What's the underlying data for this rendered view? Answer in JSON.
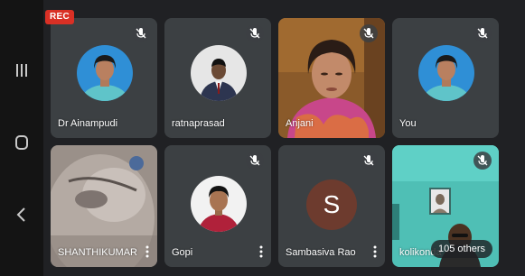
{
  "recording": {
    "label": "REC",
    "color": "#d93025"
  },
  "nav": {
    "recents_icon": "recents-icon",
    "home_icon": "home-icon",
    "back_icon": "back-icon"
  },
  "participants": [
    {
      "name": "Dr Ainampudi",
      "muted": true,
      "kind": "profile-photo"
    },
    {
      "name": "ratnaprasad",
      "muted": true,
      "kind": "profile-photo"
    },
    {
      "name": "Anjani",
      "muted": true,
      "kind": "video"
    },
    {
      "name": "You",
      "muted": true,
      "kind": "profile-photo"
    },
    {
      "name": "SHANTHIKUMAR",
      "muted": false,
      "kind": "video",
      "menu": true
    },
    {
      "name": "Gopi",
      "muted": true,
      "kind": "profile-photo",
      "menu": true
    },
    {
      "name": "Sambasiva Rao",
      "muted": true,
      "kind": "initial-avatar",
      "initial": "S",
      "avatar_color": "#6d3b2e",
      "menu": true
    },
    {
      "name": "kolikonda",
      "muted": true,
      "kind": "video"
    }
  ],
  "others": {
    "label": "105 others"
  },
  "colors": {
    "background": "#202124",
    "tile": "#3c4043",
    "navbar": "#141414"
  }
}
